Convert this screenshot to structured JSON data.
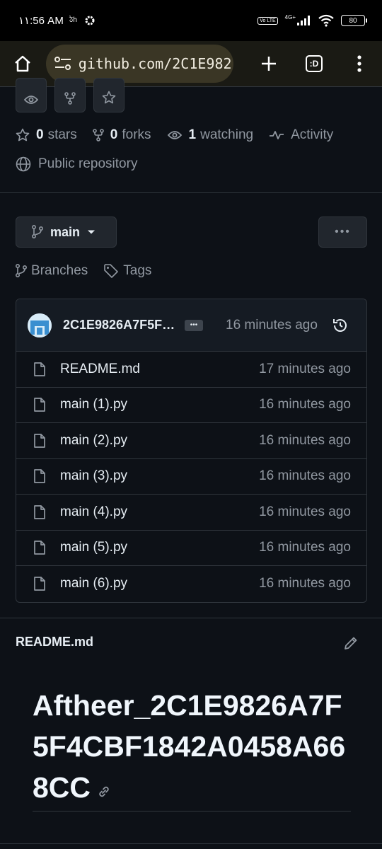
{
  "status_bar": {
    "time": "۱۱:56 AM",
    "extra": "ঠh",
    "network": "4G+",
    "volte": "Vo LTE",
    "battery": "80"
  },
  "browser": {
    "url": "github.com/2C1E982",
    "tab_count": ":D"
  },
  "repo": {
    "stars_count": "0",
    "stars_label": "stars",
    "forks_count": "0",
    "forks_label": "forks",
    "watching_count": "1",
    "watching_label": "watching",
    "activity_label": "Activity",
    "visibility": "Public repository"
  },
  "branch": {
    "name": "main",
    "more": "•••",
    "branches_label": "Branches",
    "tags_label": "Tags"
  },
  "commit": {
    "message": "2C1E9826A7F5F…",
    "dots": "•••",
    "time": "16 minutes ago"
  },
  "files": [
    {
      "name": "README.md",
      "time": "17 minutes ago"
    },
    {
      "name": "main (1).py",
      "time": "16 minutes ago"
    },
    {
      "name": "main (2).py",
      "time": "16 minutes ago"
    },
    {
      "name": "main (3).py",
      "time": "16 minutes ago"
    },
    {
      "name": "main (4).py",
      "time": "16 minutes ago"
    },
    {
      "name": "main (5).py",
      "time": "16 minutes ago"
    },
    {
      "name": "main (6).py",
      "time": "16 minutes ago"
    }
  ],
  "readme": {
    "filename": "README.md",
    "title": "Aftheer_2C1E9826A7F5F4CBF1842A0458A668CC"
  },
  "colors": {
    "background": "#0d1117",
    "border": "#30363d",
    "muted_text": "#9198a1",
    "text": "#e6edf3"
  }
}
